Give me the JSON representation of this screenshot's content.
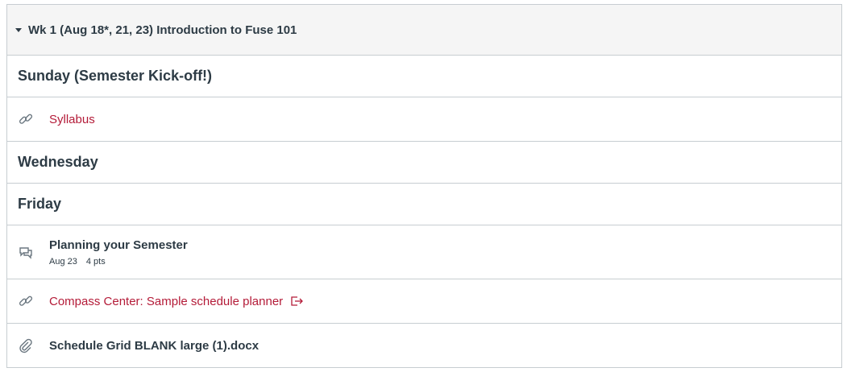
{
  "module": {
    "title": "Wk 1 (Aug 18*, 21, 23) Introduction to Fuse 101",
    "sections": [
      {
        "label": "Sunday (Semester Kick-off!)"
      },
      {
        "item": "Syllabus"
      },
      {
        "label": "Wednesday"
      },
      {
        "label": "Friday"
      },
      {
        "item": "Planning your Semester",
        "date": "Aug 23",
        "points": "4 pts"
      },
      {
        "item": "Compass Center: Sample schedule planner"
      },
      {
        "item": "Schedule Grid BLANK large (1).docx"
      }
    ]
  },
  "icons": {
    "collapse": "caret-down-icon",
    "syllabus": "link-icon",
    "planning": "discussion-icon",
    "compass": "link-icon",
    "compass_external": "external-link-icon",
    "grid": "paperclip-icon"
  },
  "colors": {
    "link": "#b41b38",
    "text": "#2d3b45",
    "border": "#c7cdd1",
    "header_bg": "#f5f5f5"
  }
}
